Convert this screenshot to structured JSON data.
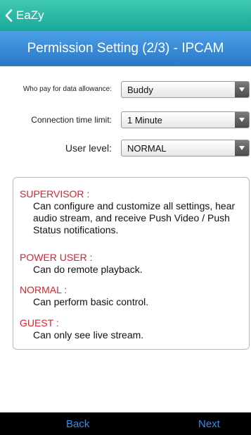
{
  "nav": {
    "back_label": "EaZy"
  },
  "header": {
    "title": "Permission Setting (2/3) - IPCAM"
  },
  "form": {
    "data_allowance": {
      "label": "Who pay for data allowance:",
      "value": "Buddy"
    },
    "connection_time_limit": {
      "label": "Connection time limit:",
      "value": "1 Minute"
    },
    "user_level": {
      "label": "User level:",
      "value": "NORMAL"
    }
  },
  "levels": [
    {
      "name": "SUPERVISOR :",
      "desc": "Can configure and customize all settings, hear audio stream, and receive Push Video / Push Status notifications."
    },
    {
      "name": "POWER USER :",
      "desc": "Can do remote playback."
    },
    {
      "name": "NORMAL :",
      "desc": "Can perform basic control."
    },
    {
      "name": "GUEST :",
      "desc": "Can only see live stream."
    }
  ],
  "footer": {
    "back_label": "Back",
    "next_label": "Next"
  },
  "colors": {
    "topbar": "#2bb8a6",
    "titlebar": "#3a8ad8",
    "level_name": "#e0202a",
    "footer_bg": "#000000",
    "footer_text": "#2e8ef0"
  },
  "icons": {
    "back": "chevron-left-icon",
    "dropdown": "triangle-down-icon"
  }
}
